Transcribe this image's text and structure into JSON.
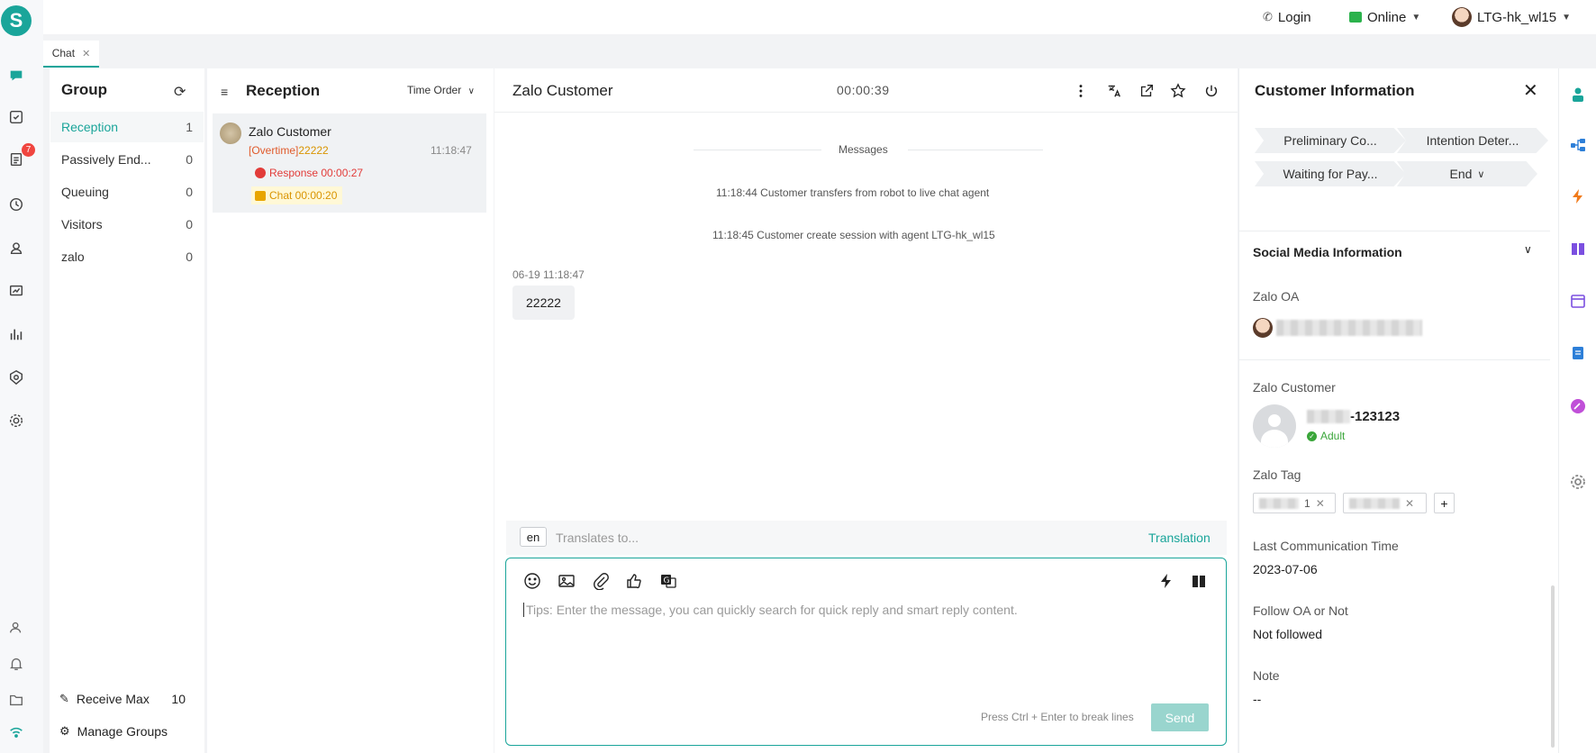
{
  "topbar": {
    "login": "Login",
    "status": "Online",
    "agent": "LTG-hk_wl15"
  },
  "rail": {
    "logo": "S",
    "badge": "7",
    "icons": [
      "chat-icon",
      "task-icon",
      "ticket-icon",
      "history-icon",
      "contacts-icon",
      "monitor-icon",
      "report-icon",
      "security-icon",
      "settings-icon",
      "agent-icon",
      "bell-icon",
      "folder-icon",
      "wifi-icon"
    ]
  },
  "tabs": [
    {
      "label": "Chat",
      "close": "✕"
    }
  ],
  "group": {
    "title": "Group",
    "items": [
      {
        "label": "Reception",
        "count": "1"
      },
      {
        "label": "Passively End...",
        "count": "0"
      },
      {
        "label": "Queuing",
        "count": "0"
      },
      {
        "label": "Visitors",
        "count": "0"
      },
      {
        "label": "zalo",
        "count": "0"
      }
    ],
    "receive_max_label": "Receive Max",
    "receive_max_value": "10",
    "manage_groups": "Manage Groups"
  },
  "reception": {
    "title": "Reception",
    "sort": "Time Order",
    "card": {
      "name": "Zalo Customer",
      "overtime": "[Overtime]",
      "preview": "22222",
      "time": "11:18:47",
      "response": "Response 00:00:27",
      "chat": "Chat 00:00:20"
    }
  },
  "chat": {
    "title": "Zalo Customer",
    "timer": "00:00:39",
    "messages_label": "Messages",
    "system": [
      "11:18:44 Customer transfers from robot to live chat agent",
      "11:18:45 Customer create session with agent LTG-hk_wl15"
    ],
    "msg_meta": "06-19 11:18:47",
    "msg_text": "22222",
    "lang": "en",
    "translate_placeholder": "Translates to...",
    "translation_btn": "Translation",
    "compose_placeholder": "Tips: Enter the message, you can quickly search for quick reply and smart reply content.",
    "hint": "Press Ctrl + Enter to break lines",
    "send": "Send"
  },
  "info": {
    "title": "Customer Information",
    "stages": [
      "Preliminary Co...",
      "Intention Deter...",
      "Waiting for Pay...",
      "End"
    ],
    "social_title": "Social Media Information",
    "zalo_oa_label": "Zalo OA",
    "zalo_customer_label": "Zalo Customer",
    "customer_id_suffix": "-123123",
    "adult": "Adult",
    "zalo_tag_label": "Zalo Tag",
    "tag1_suffix": "1",
    "tag_add": "+",
    "last_comm_label": "Last Communication Time",
    "last_comm_value": "2023-07-06",
    "follow_label": "Follow OA or Not",
    "follow_value": "Not followed",
    "note_label": "Note",
    "note_value": "--"
  },
  "colors": {
    "accent": "#1aa59a",
    "danger": "#e23c39",
    "warning": "#d99400",
    "online": "#2bb24c"
  }
}
